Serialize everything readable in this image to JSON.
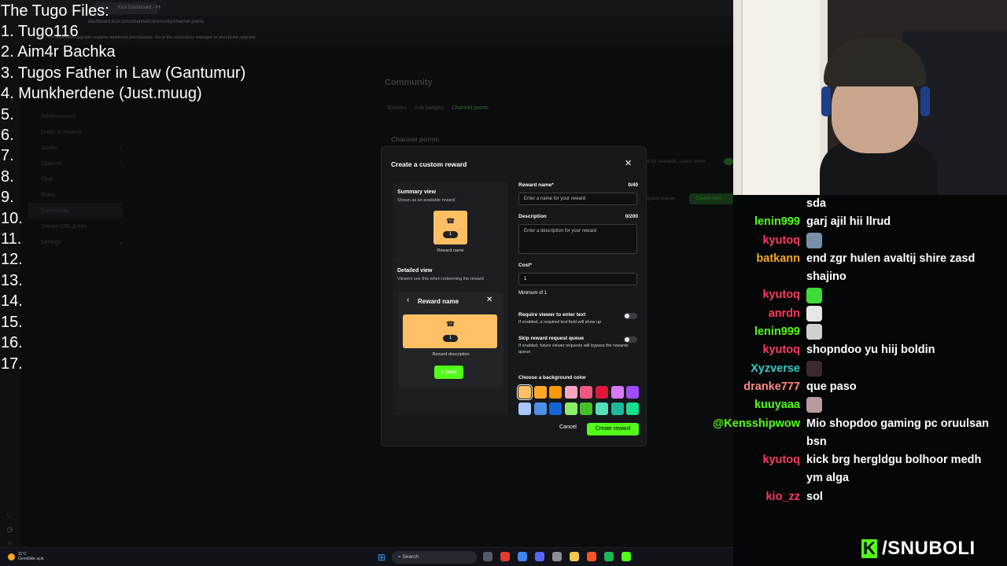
{
  "browser": {
    "tab_label": "Kick Dashboard - Kick De",
    "url": "dashboard.kick.com/channel/community/channel-points",
    "extension_notice": "The extension upgrade requires additional permissions. Go to the extensions manager to accept the upgrade.",
    "nav": {
      "achievements": "Achievements",
      "drops": "Drops & rewards",
      "studio": "Studio",
      "channel": "Channel",
      "chat": "Chat",
      "roles": "Roles",
      "community": "Community",
      "stream_url": "Stream URL & Key",
      "settings": "Settings"
    },
    "page": {
      "title": "Community",
      "tabs": [
        "Emotes",
        "Sub badges",
        "Channel points"
      ],
      "active_tab": "Channel points",
      "section_title": "Channel points",
      "rewards_note": "d for rewards. Learn more",
      "queue_note": "quest queue",
      "create_new": "Create new"
    }
  },
  "overlay": {
    "title": "The Tugo Files:",
    "items": [
      "1. Tugo116",
      "2. Aim4r Bachka",
      "3. Tugos Father in Law (Gantumur)",
      "4. Munkherdene (Just.muug)",
      "5.",
      "6.",
      "7.",
      "8.",
      "9.",
      "10.",
      "11.",
      "12.",
      "13.",
      "14.",
      "15.",
      "16.",
      "17."
    ]
  },
  "modal": {
    "title": "Create a custom reward",
    "summary_title": "Summary view",
    "summary_sub": "Shown as an available reward",
    "tile_cost": "1",
    "tile_label": "Reward name",
    "detailed_title": "Detailed view",
    "detailed_sub": "Viewers see this when redeeming the reward",
    "detail_name": "Reward name",
    "detail_cost": "1",
    "detail_desc": "Reward description",
    "detail_points": "1 point",
    "reward_name_label": "Reward name*",
    "reward_name_count": "0/40",
    "reward_name_placeholder": "Enter a name for your reward",
    "description_label": "Description",
    "description_count": "0/200",
    "description_placeholder": "Enter a description for your reward",
    "cost_label": "Cost*",
    "cost_value": "1",
    "cost_hint": "Minimum of 1",
    "require_text_label": "Require viewer to enter text",
    "require_text_help": "If enabled, a required text field will show up",
    "skip_queue_label": "Skip reward request queue",
    "skip_queue_help": "If enabled, future viewer requests will bypass the rewards queue",
    "color_label": "Choose a background color",
    "colors": [
      "#ffc065",
      "#ffa726",
      "#ff9800",
      "#f8a5c2",
      "#ee5a7e",
      "#e0163d",
      "#d67bff",
      "#a24bff",
      "#a8c7ff",
      "#4d8fe8",
      "#1565d8",
      "#8bee6a",
      "#44c02a",
      "#54e0b8",
      "#1fb89a",
      "#18dd8c"
    ],
    "selected_color": "#ffc065",
    "cancel_label": "Cancel",
    "create_label": "Create reward"
  },
  "chat": {
    "messages": [
      {
        "user": "",
        "text": "sda",
        "color": "#ffffff"
      },
      {
        "user": "lenin999",
        "text": "garj ajil hii llrud",
        "color": "#53fc18"
      },
      {
        "user": "kyutoq",
        "text": "",
        "emote": "#7a8fa8",
        "color": "#ff3b5c"
      },
      {
        "user": "batkann",
        "text": "end zgr hulen avaltij shire zasd shajino",
        "color": "#f5a623"
      },
      {
        "user": "kyutoq",
        "text": "",
        "emote": "#3ddc3a",
        "color": "#ff3b5c"
      },
      {
        "user": "anrdn",
        "text": "",
        "emote": "#e6e6e6",
        "color": "#ff3b5c"
      },
      {
        "user": "lenin999",
        "text": "",
        "emote": "#d0d0d0",
        "color": "#53fc18"
      },
      {
        "user": "kyutoq",
        "text": "shopndoo yu hiij boldin",
        "color": "#ff3b5c"
      },
      {
        "user": "Xyzverse",
        "text": "",
        "emote": "#3a2a30",
        "color": "#33c7c0"
      },
      {
        "user": "dranke777",
        "text": "que paso",
        "color": "#ff8a80"
      },
      {
        "user": "kuuyaaa",
        "text": "",
        "emote": "#b89aa0",
        "color": "#53fc18"
      },
      {
        "user": "@Kensshipwow",
        "text": "Mio shopdoo gaming pc oruulsan bsn",
        "color": "#53fc18"
      },
      {
        "user": "kyutoq",
        "text": "kick brg hergldgu bolhoor medh ym alga",
        "color": "#ff3b5c"
      },
      {
        "user": "kio_zz",
        "text": "sol",
        "color": "#ff3b5c"
      }
    ]
  },
  "brand": {
    "letter": "K",
    "name": "/SNUBOLI"
  },
  "taskbar": {
    "weather_temp": "11°C",
    "weather_desc": "Genellikle açık",
    "search_label": "Search"
  }
}
